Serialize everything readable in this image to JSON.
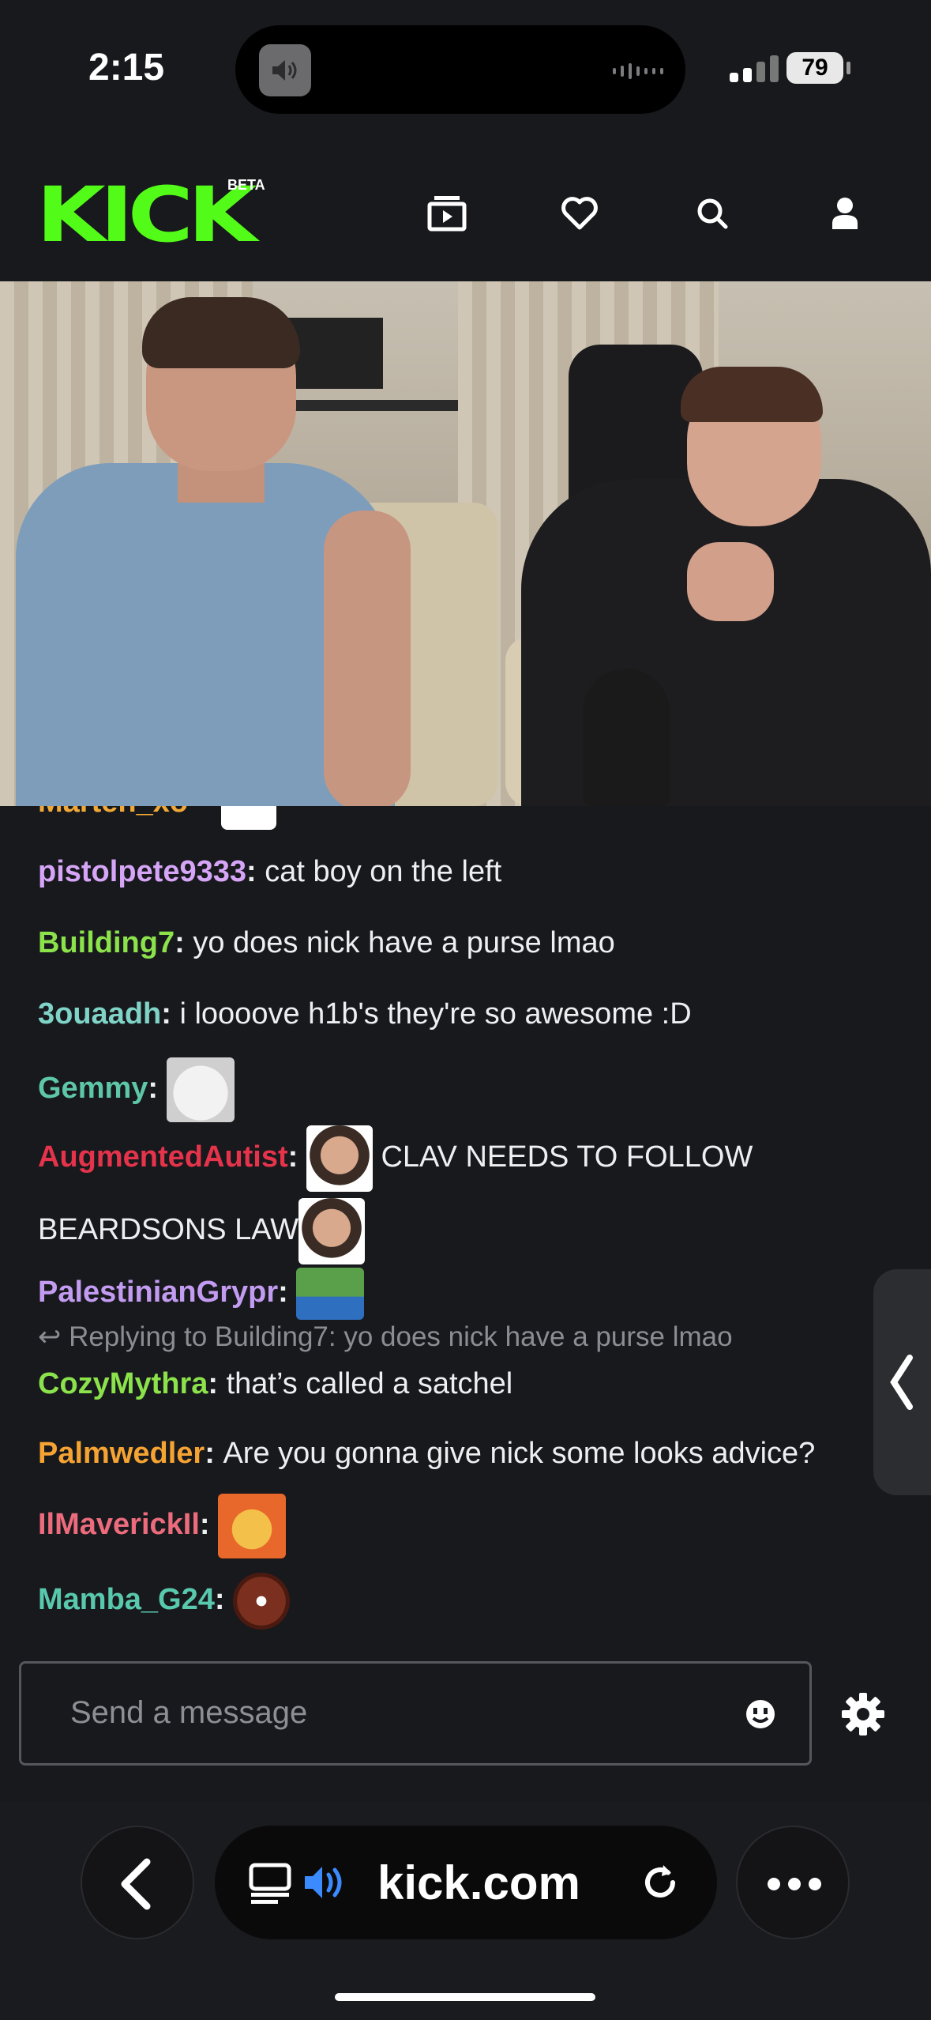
{
  "status_bar": {
    "time": "2:15",
    "battery": "79"
  },
  "header": {
    "logo": "KICK",
    "beta": "BETA"
  },
  "chat": {
    "cut_off_user": "Marten_xo",
    "messages": [
      {
        "user": "pistolpete9333",
        "color": "#d6a5f7",
        "text": "cat boy on the left"
      },
      {
        "user": "Building7",
        "color": "#8be24b",
        "text": "yo does nick have a purse lmao"
      },
      {
        "user": "3ouaadh",
        "color": "#7fd3c7",
        "text": "i loooove h1b's they're so awesome :D"
      },
      {
        "user": "Gemmy",
        "color": "#5ec7a8",
        "text": ""
      },
      {
        "user": "AugmentedAutist",
        "color": "#e5334b",
        "text": "CLAV NEEDS TO FOLLOW",
        "text2": "BEARDSONS LAW"
      },
      {
        "user": "PalestinianGrypr",
        "color": "#c39cf2",
        "text": ""
      },
      {
        "user": "CozyMythra",
        "color": "#8be24b",
        "text": "that’s called a satchel"
      },
      {
        "user": "Palmwedler",
        "color": "#f5a332",
        "text": "Are you gonna give nick some looks advice?"
      },
      {
        "user": "IlMaverickIl",
        "color": "#ec6b7c",
        "text": ""
      },
      {
        "user": "Mamba_G24",
        "color": "#59c9ae",
        "text": ""
      }
    ],
    "reply": "Replying to Building7: yo does nick have a purse lmao"
  },
  "input": {
    "placeholder": "Send a message"
  },
  "browser": {
    "url": "kick.com"
  }
}
